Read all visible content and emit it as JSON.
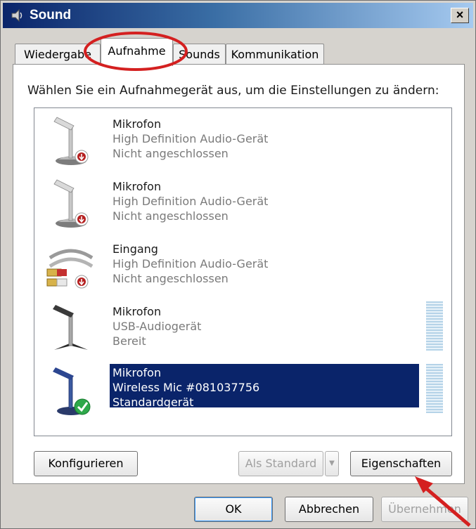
{
  "window": {
    "title": "Sound",
    "close_glyph": "×"
  },
  "tabs": [
    {
      "label": "Wiedergabe"
    },
    {
      "label": "Aufnahme"
    },
    {
      "label": "Sounds"
    },
    {
      "label": "Kommunikation"
    }
  ],
  "instruction": "Wählen Sie ein Aufnahmegerät aus, um die Einstellungen zu ändern:",
  "devices": [
    {
      "name": "Mikrofon",
      "driver": "High Definition Audio-Gerät",
      "status": "Nicht angeschlossen",
      "icon": "microphone-disconnected-icon"
    },
    {
      "name": "Mikrofon",
      "driver": "High Definition Audio-Gerät",
      "status": "Nicht angeschlossen",
      "icon": "microphone-disconnected-icon"
    },
    {
      "name": "Eingang",
      "driver": "High Definition Audio-Gerät",
      "status": "Nicht angeschlossen",
      "icon": "line-in-cable-icon"
    },
    {
      "name": "Mikrofon",
      "driver": "USB-Audiogerät",
      "status": "Bereit",
      "icon": "microphone-icon"
    },
    {
      "name": "Mikrofon",
      "driver": "Wireless Mic #081037756",
      "status": "Standardgerät",
      "icon": "microphone-default-icon",
      "selected": true
    }
  ],
  "buttons": {
    "configure": "Konfigurieren",
    "set_default": "Als Standard",
    "properties": "Eigenschaften",
    "ok": "OK",
    "cancel": "Abbrechen",
    "apply": "Übernehmen"
  },
  "colors": {
    "selection": "#0a246a",
    "annotation": "#d42020",
    "title_bar": "#0a246a"
  }
}
